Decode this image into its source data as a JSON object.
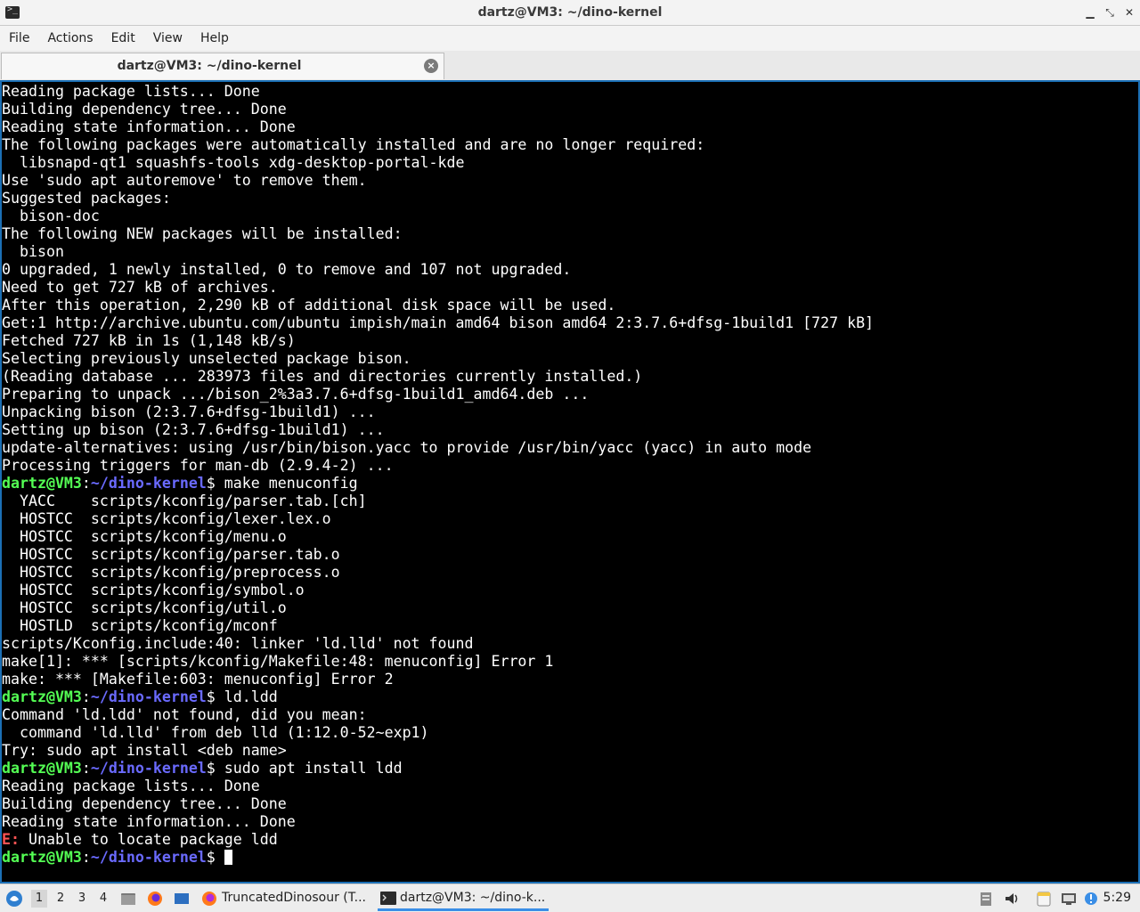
{
  "window": {
    "title": "dartz@VM3: ~/dino-kernel",
    "tab_label": "dartz@VM3: ~/dino-kernel",
    "tab_close_glyph": "×",
    "controls": {
      "minimize": "▁",
      "maximize": "⤡",
      "close": "✕"
    }
  },
  "menu": [
    "File",
    "Actions",
    "Edit",
    "View",
    "Help"
  ],
  "prompt": {
    "user": "dartz@VM3",
    "sep": ":",
    "path": "~/dino-kernel",
    "symbol": "$"
  },
  "terminal_lines": [
    {
      "t": "Reading package lists... Done"
    },
    {
      "t": "Building dependency tree... Done"
    },
    {
      "t": "Reading state information... Done"
    },
    {
      "t": "The following packages were automatically installed and are no longer required:"
    },
    {
      "t": "  libsnapd-qt1 squashfs-tools xdg-desktop-portal-kde"
    },
    {
      "t": "Use 'sudo apt autoremove' to remove them."
    },
    {
      "t": "Suggested packages:"
    },
    {
      "t": "  bison-doc"
    },
    {
      "t": "The following NEW packages will be installed:"
    },
    {
      "t": "  bison"
    },
    {
      "t": "0 upgraded, 1 newly installed, 0 to remove and 107 not upgraded."
    },
    {
      "t": "Need to get 727 kB of archives."
    },
    {
      "t": "After this operation, 2,290 kB of additional disk space will be used."
    },
    {
      "t": "Get:1 http://archive.ubuntu.com/ubuntu impish/main amd64 bison amd64 2:3.7.6+dfsg-1build1 [727 kB]"
    },
    {
      "t": "Fetched 727 kB in 1s (1,148 kB/s)"
    },
    {
      "t": "Selecting previously unselected package bison."
    },
    {
      "t": "(Reading database ... 283973 files and directories currently installed.)"
    },
    {
      "t": "Preparing to unpack .../bison_2%3a3.7.6+dfsg-1build1_amd64.deb ..."
    },
    {
      "t": "Unpacking bison (2:3.7.6+dfsg-1build1) ..."
    },
    {
      "t": "Setting up bison (2:3.7.6+dfsg-1build1) ..."
    },
    {
      "t": "update-alternatives: using /usr/bin/bison.yacc to provide /usr/bin/yacc (yacc) in auto mode"
    },
    {
      "t": "Processing triggers for man-db (2.9.4-2) ..."
    },
    {
      "cmd": " make menuconfig"
    },
    {
      "t": "  YACC    scripts/kconfig/parser.tab.[ch]"
    },
    {
      "t": "  HOSTCC  scripts/kconfig/lexer.lex.o"
    },
    {
      "t": "  HOSTCC  scripts/kconfig/menu.o"
    },
    {
      "t": "  HOSTCC  scripts/kconfig/parser.tab.o"
    },
    {
      "t": "  HOSTCC  scripts/kconfig/preprocess.o"
    },
    {
      "t": "  HOSTCC  scripts/kconfig/symbol.o"
    },
    {
      "t": "  HOSTCC  scripts/kconfig/util.o"
    },
    {
      "t": "  HOSTLD  scripts/kconfig/mconf"
    },
    {
      "t": "scripts/Kconfig.include:40: linker 'ld.lld' not found"
    },
    {
      "t": "make[1]: *** [scripts/kconfig/Makefile:48: menuconfig] Error 1"
    },
    {
      "t": "make: *** [Makefile:603: menuconfig] Error 2"
    },
    {
      "cmd": " ld.ldd"
    },
    {
      "t": "Command 'ld.ldd' not found, did you mean:"
    },
    {
      "t": "  command 'ld.lld' from deb lld (1:12.0-52~exp1)"
    },
    {
      "t": "Try: sudo apt install <deb name>"
    },
    {
      "cmd": " sudo apt install ldd"
    },
    {
      "t": "Reading package lists... Done"
    },
    {
      "t": "Building dependency tree... Done"
    },
    {
      "t": "Reading state information... Done"
    },
    {
      "err": "E:",
      "t": " Unable to locate package ldd"
    },
    {
      "cmd": " ",
      "cursor": true
    }
  ],
  "taskbar": {
    "workspaces": [
      "1",
      "2",
      "3",
      "4"
    ],
    "active_workspace": "1",
    "tasks": [
      {
        "label": "TruncatedDinosour (T...",
        "icon": "firefox-icon"
      },
      {
        "label": "dartz@VM3: ~/dino-k...",
        "icon": "terminal-icon"
      }
    ],
    "clock": "5:29",
    "colors": {
      "accent": "#3a8ee6",
      "prompt_user": "#54ff54",
      "prompt_path": "#6a6aff",
      "error": "#ff5454"
    }
  }
}
